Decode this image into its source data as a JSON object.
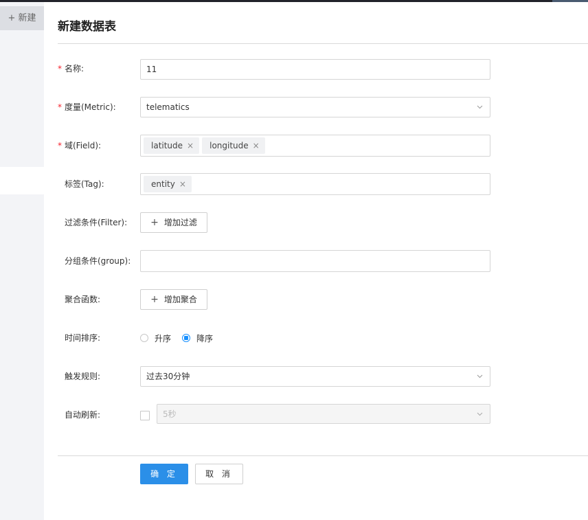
{
  "sidebar": {
    "new_label": "+ 新建"
  },
  "page": {
    "title": "新建数据表"
  },
  "form": {
    "name": {
      "label": "名称:",
      "value": "11"
    },
    "metric": {
      "label": "度量(Metric):",
      "value": "telematics"
    },
    "field": {
      "label": "域(Field):",
      "tags": [
        "latitude",
        "longitude"
      ]
    },
    "tag": {
      "label": "标签(Tag):",
      "tags": [
        "entity"
      ]
    },
    "filter": {
      "label": "过滤条件(Filter):",
      "button": "增加过滤"
    },
    "group": {
      "label": "分组条件(group):",
      "value": ""
    },
    "aggregate": {
      "label": "聚合函数:",
      "button": "增加聚合"
    },
    "time_sort": {
      "label": "时间排序:",
      "options": [
        "升序",
        "降序"
      ],
      "selected": "降序"
    },
    "trigger": {
      "label": "触发规则:",
      "value": "过去30分钟"
    },
    "auto_refresh": {
      "label": "自动刷新:",
      "checked": false,
      "value": "5秒"
    }
  },
  "actions": {
    "confirm": "确 定",
    "cancel": "取 消"
  },
  "icons": {
    "remove": "close-icon",
    "add": "plus-icon",
    "dropdown": "chevron-down-icon"
  },
  "colors": {
    "primary": "#2b8fe8",
    "required": "#f5222d",
    "sidebar_bg": "#f3f4f7"
  }
}
